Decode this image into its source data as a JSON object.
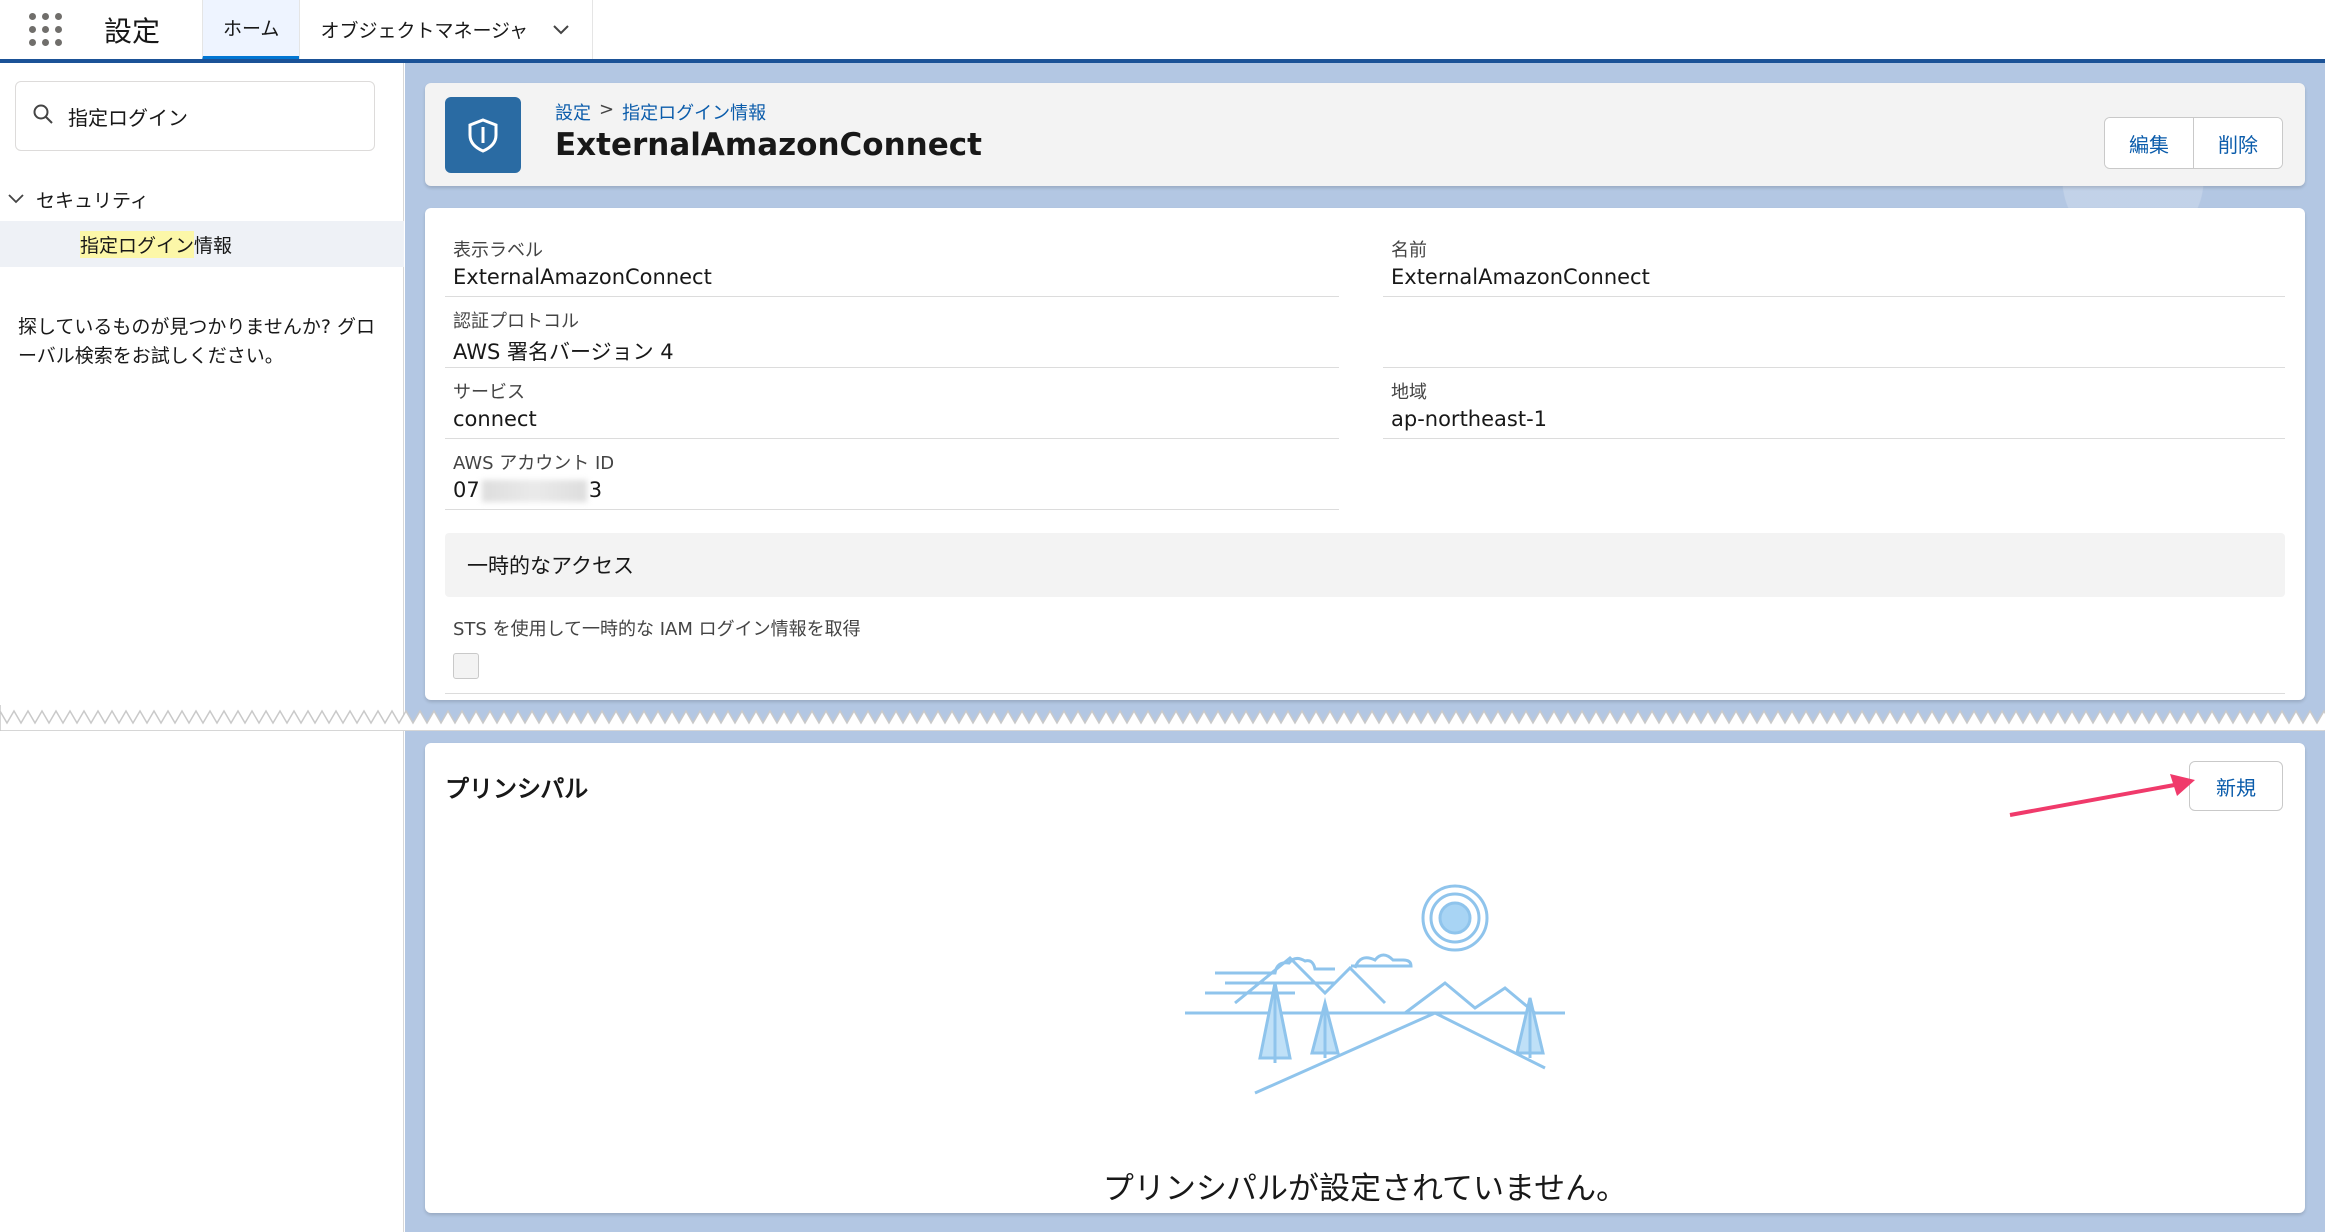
{
  "topbar": {
    "app_name": "設定",
    "tabs": [
      {
        "label": "ホーム"
      },
      {
        "label": "オブジェクトマネージャ"
      }
    ]
  },
  "sidebar": {
    "search_value": "指定ログイン",
    "group_label": "セキュリティ",
    "item_label_highlight": "指定ログイン",
    "item_label_rest": "情報",
    "help_text": "探しているものが見つかりませんか? グローバル検索をお試しください。"
  },
  "header": {
    "breadcrumb": [
      "設定",
      "指定ログイン情報"
    ],
    "breadcrumb_sep": ">",
    "title": "ExternalAmazonConnect",
    "edit_label": "編集",
    "delete_label": "削除"
  },
  "detail": {
    "fields": [
      {
        "label": "表示ラベル",
        "value": "ExternalAmazonConnect"
      },
      {
        "label": "名前",
        "value": "ExternalAmazonConnect"
      },
      {
        "label": "認証プロトコル",
        "value": "AWS 署名バージョン 4"
      },
      {
        "label": "サービス",
        "value": "connect"
      },
      {
        "label": "地域",
        "value": "ap-northeast-1"
      },
      {
        "label": "AWS アカウント ID",
        "value_prefix": "07",
        "value_suffix": "3"
      }
    ],
    "section_title": "一時的なアクセス",
    "sts_label": "STS を使用して一時的な IAM ログイン情報を取得",
    "sts_checked": false
  },
  "principal": {
    "title": "プリンシパル",
    "new_label": "新規",
    "empty_message": "プリンシパルが設定されていません。"
  },
  "colors": {
    "brand_blue": "#0176d3",
    "link_blue": "#0b5cab",
    "header_icon": "#2a6ba3",
    "arrow": "#f03a6b",
    "highlight": "#fcf7a8"
  }
}
